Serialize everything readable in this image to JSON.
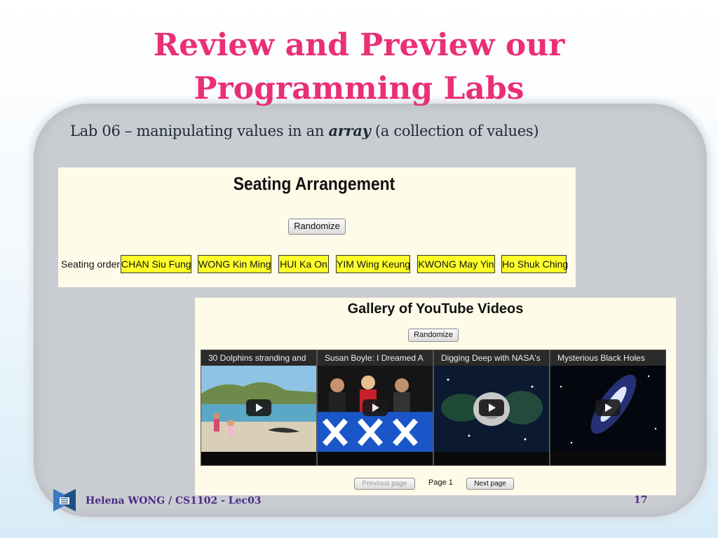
{
  "slide": {
    "title_line1": "Review and Preview our",
    "title_line2": "Programming Labs",
    "subtitle_prefix": "Lab 06 – manipulating values in an ",
    "subtitle_emphasis": "array",
    "subtitle_suffix": " (a collection of values)"
  },
  "seating": {
    "title": "Seating Arrangement",
    "randomize_label": "Randomize",
    "order_label": "Seating order:",
    "names": [
      "CHAN Siu Fung",
      "WONG Kin Ming",
      "HUI Ka On",
      "YIM Wing Keung",
      "KWONG May Yin",
      "Ho Shuk Ching"
    ]
  },
  "gallery": {
    "title": "Gallery of YouTube Videos",
    "randomize_label": "Randomize",
    "videos": [
      {
        "title": "30 Dolphins stranding and"
      },
      {
        "title": "Susan Boyle: I Dreamed A"
      },
      {
        "title": "Digging Deep with NASA's"
      },
      {
        "title": "Mysterious Black Holes"
      }
    ],
    "prev_label": "Previous page",
    "page_label": "Page 1",
    "next_label": "Next page"
  },
  "footer": {
    "author": "Helena WONG / CS1102 - Lec03",
    "page_number": "17"
  },
  "colors": {
    "title": "#ea2f74",
    "name_bg": "#ffff29",
    "footer": "#4a2a84"
  }
}
